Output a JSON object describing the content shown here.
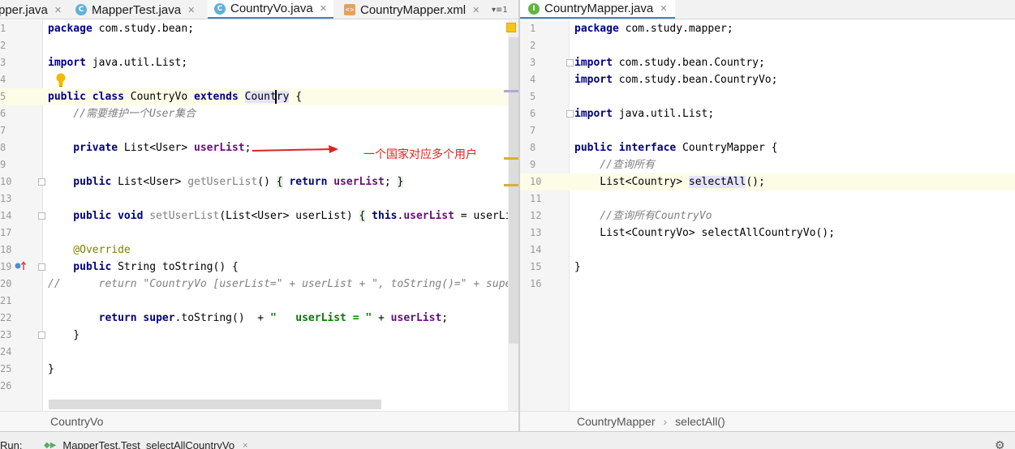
{
  "tabs_left": [
    {
      "label": "pper.java",
      "icon": "",
      "active": false
    },
    {
      "label": "MapperTest.java",
      "icon": "C",
      "active": false
    },
    {
      "label": "CountryVo.java",
      "icon": "C",
      "active": true
    },
    {
      "label": "CountryMapper.xml",
      "icon": "<>",
      "active": false
    }
  ],
  "tab_overflow": "▾≡1",
  "tabs_right": [
    {
      "label": "CountryMapper.java",
      "icon": "I",
      "active": true
    }
  ],
  "left_editor": {
    "line_numbers": [
      "1",
      "2",
      "3",
      "4",
      "5",
      "6",
      "7",
      "8",
      "9",
      "10",
      "13",
      "14",
      "17",
      "18",
      "19",
      "20",
      "21",
      "22",
      "23",
      "24",
      "25",
      "26"
    ],
    "annotation_note": "一个国家对应多个用户",
    "lines": {
      "l1_kw": "package",
      "l1_rest": " com.study.bean;",
      "l3_kw": "import",
      "l3_rest": " java.util.List;",
      "l5_kw1": "public class",
      "l5_a": " CountryVo ",
      "l5_kw2": "extends",
      "l5_sp": " ",
      "l5_ident": "Country",
      "l5_rest": " {",
      "l6_cmt": "    //需要维护一个User集合",
      "l8_kw": "    private",
      "l8_a": " List<User> ",
      "l8_fld": "userList",
      "l8_rest": ";",
      "l10_kw": "    public",
      "l10_a": " List<User> ",
      "l10_m": "getUserList",
      "l10_b": "() ",
      "l10_br1": "{",
      "l10_sp": " ",
      "l10_kw2": "return",
      "l10_sp2": " ",
      "l10_fld": "userList",
      "l10_c": "; ",
      "l10_br2": "}",
      "l14_kw": "    public void",
      "l14_sp": " ",
      "l14_m": "setUserList",
      "l14_a": "(List<User> userList) ",
      "l14_br": "{",
      "l14_sp2": " ",
      "l14_kw2": "this",
      "l14_dot": ".",
      "l14_fld": "userList",
      "l14_rest": " = userLi",
      "l18_ann": "    @Override",
      "l19_kw": "    public",
      "l19_rest": " String toString() {",
      "l20_cmt": "//      return \"CountryVo [userList=\" + userList + \", toString()=\" + super",
      "l22_sp": "        ",
      "l22_kw": "return super",
      "l22_a": ".toString()  + ",
      "l22_str": "\"   userList = \"",
      "l22_b": " + ",
      "l22_fld": "userList",
      "l22_rest": ";",
      "l23_text": "    }",
      "l25_text": "}"
    }
  },
  "right_editor": {
    "line_numbers": [
      "1",
      "2",
      "3",
      "4",
      "5",
      "6",
      "7",
      "8",
      "9",
      "10",
      "11",
      "12",
      "13",
      "14",
      "15",
      "16"
    ],
    "lines": {
      "l1_kw": "package",
      "l1_rest": " com.study.mapper;",
      "l3_kw": "import",
      "l3_rest": " com.study.bean.Country;",
      "l4_kw": "import",
      "l4_rest": " com.study.bean.CountryVo;",
      "l6_kw": "import",
      "l6_rest": " java.util.List;",
      "l8_kw": "public interface",
      "l8_rest": " CountryMapper {",
      "l9_cmt": "    //查询所有",
      "l10_a": "    List<Country> ",
      "l10_ident": "selectAll",
      "l10_rest": "();",
      "l12_cmt": "    //查询所有CountryVo",
      "l13_text": "    List<CountryVo> selectAllCountryVo();",
      "l15_text": "}"
    }
  },
  "breadcrumb_left": "CountryVo",
  "breadcrumb_right": [
    "CountryMapper",
    "selectAll()"
  ],
  "breadcrumb_sep": "›",
  "run_bar": {
    "label": "Run:",
    "tab": "MapperTest.Test_selectAllCountryVo",
    "close": "×"
  },
  "colors": {
    "keyword": "#000080",
    "field": "#660e7a",
    "string": "#008000",
    "comment": "#808080",
    "annotation_arrow": "#e02222"
  },
  "icons": [
    "class-icon",
    "interface-icon",
    "xml-icon",
    "close-icon",
    "lightbulb-icon",
    "override-icon",
    "fold-icon",
    "run-icon",
    "gear-icon"
  ]
}
